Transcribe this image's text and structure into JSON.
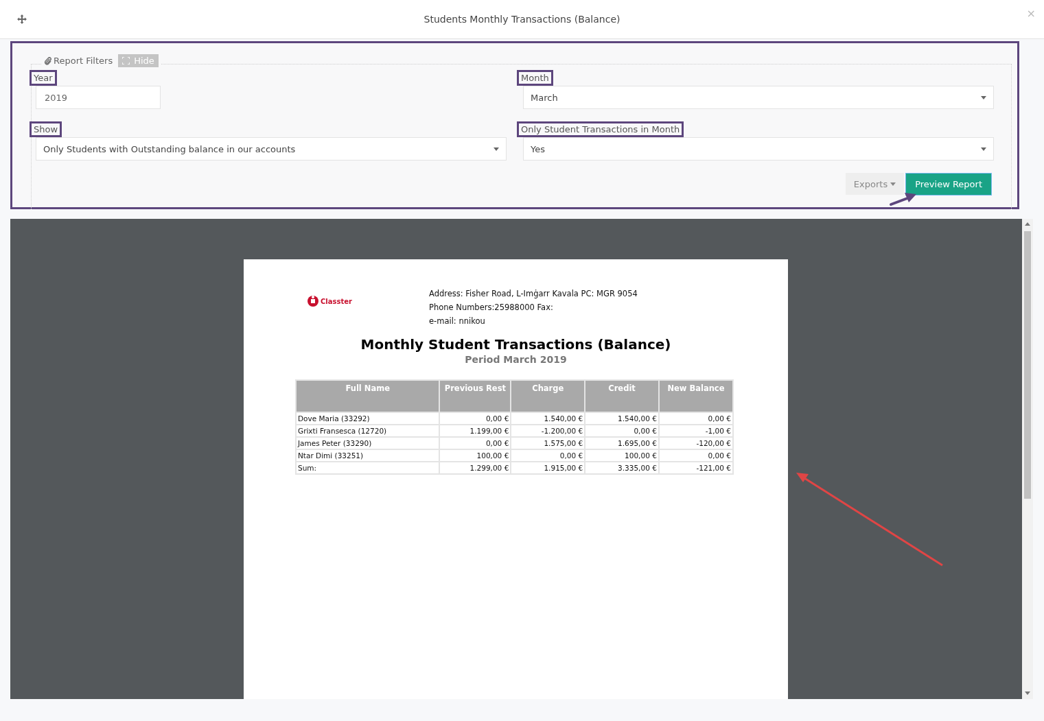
{
  "window": {
    "title": "Students Monthly Transactions (Balance)",
    "close": "×"
  },
  "filters": {
    "legend": "Report Filters",
    "hide_button": "Hide",
    "fields": [
      {
        "label": "Year",
        "value": "2019",
        "kind": "text"
      },
      {
        "label": "Month",
        "value": "March",
        "kind": "select"
      },
      {
        "label": "Show",
        "value": "Only Students with Outstanding balance in our accounts",
        "kind": "select"
      },
      {
        "label": "Only Student Transactions in Month",
        "value": "Yes",
        "kind": "select"
      }
    ],
    "exports_button": "Exports",
    "preview_button": "Preview Report"
  },
  "report": {
    "logo_text": "Classter",
    "address_lines": [
      "Address: Fisher Road, L-Imġarr  Kavala PC: MGR 9054",
      "Phone Numbers:25988000  Fax:",
      "e-mail: nnikou"
    ],
    "title": "Monthly Student Transactions (Balance)",
    "period": "Period March 2019",
    "columns": [
      "Full Name",
      "Previous Rest",
      "Charge",
      "Credit",
      "New Balance"
    ],
    "rows": [
      [
        "Dove Maria (33292)",
        "0,00 €",
        "1.540,00 €",
        "1.540,00 €",
        "0,00 €"
      ],
      [
        "Grixti Fransesca (12720)",
        "1.199,00 €",
        "-1.200,00 €",
        "0,00 €",
        "-1,00 €"
      ],
      [
        "James Peter (33290)",
        "0,00 €",
        "1.575,00 €",
        "1.695,00 €",
        "-120,00 €"
      ],
      [
        "Ntar Dimi (33251)",
        "100,00 €",
        "0,00 €",
        "100,00 €",
        "0,00 €"
      ],
      [
        "Sum:",
        "1.299,00 €",
        "1.915,00 €",
        "3.335,00 €",
        "-121,00 €"
      ]
    ]
  }
}
